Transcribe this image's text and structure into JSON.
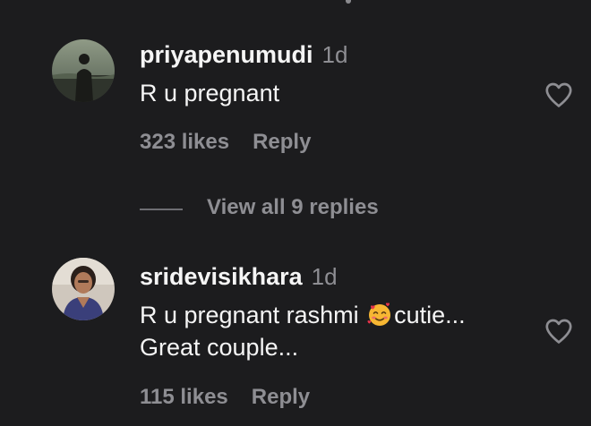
{
  "comments": [
    {
      "username": "priyapenumudi",
      "time": "1d",
      "text_lines": [
        "R u pregnant"
      ],
      "likes": "323 likes",
      "reply_label": "Reply",
      "avatar_icon": "profile-photo-seaside-silhouette",
      "like_icon": "heart-outline-icon"
    },
    {
      "username": "sridevisikhara",
      "time": "1d",
      "text_line1_before_emoji": "R u pregnant rashmi ",
      "emoji_icon": "smiling-face-with-hearts-emoji",
      "text_line1_after_emoji": "cutie...",
      "text_line2": "Great couple...",
      "likes": "115 likes",
      "reply_label": "Reply",
      "avatar_icon": "profile-photo-woman",
      "like_icon": "heart-outline-icon"
    }
  ],
  "view_replies": {
    "label": "View all 9 replies"
  },
  "colors": {
    "background": "#1c1c1e",
    "primary_text": "#f5f5f5",
    "secondary_text": "#8e8e93",
    "divider": "#6e6e73"
  }
}
